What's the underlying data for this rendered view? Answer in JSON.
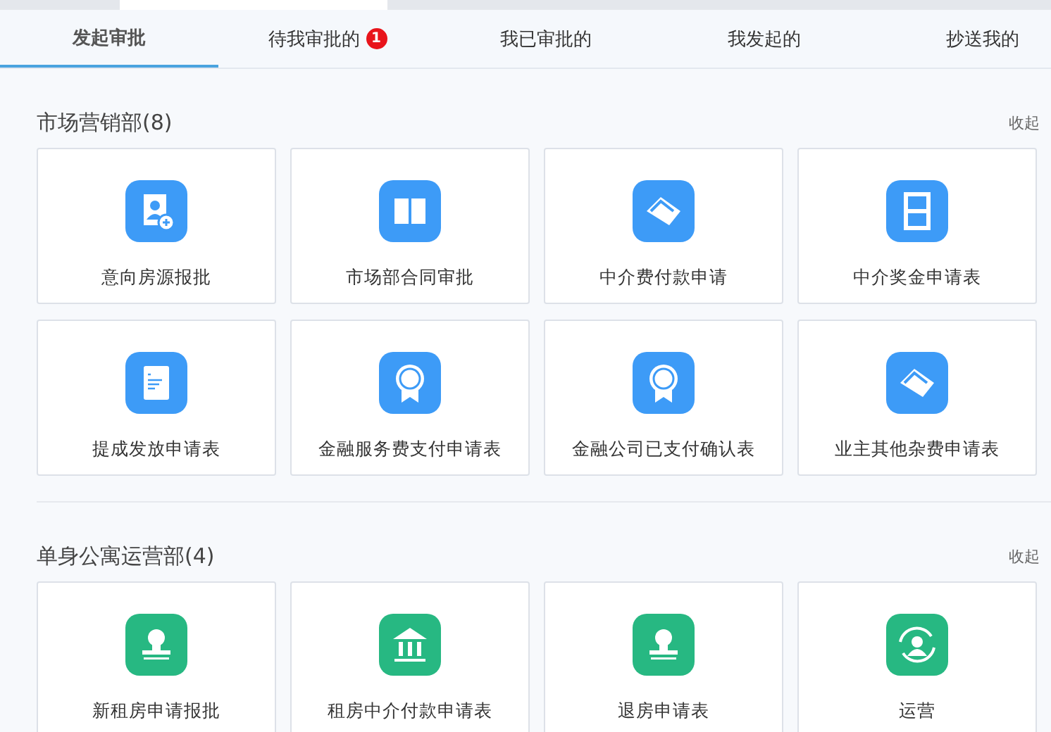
{
  "tabs": [
    {
      "label": "发起审批",
      "selected": true
    },
    {
      "label": "待我审批的",
      "selected": false,
      "badge": "1"
    },
    {
      "label": "我已审批的",
      "selected": false
    },
    {
      "label": "我发起的",
      "selected": false
    },
    {
      "label": "抄送我的",
      "selected": false
    }
  ],
  "sections": [
    {
      "title": "市场营销部(8)",
      "toggle": "收起",
      "color": "#3d9bf7",
      "cards": [
        {
          "label": "意向房源报批",
          "kind": "portrait"
        },
        {
          "label": "市场部合同审批",
          "kind": "book"
        },
        {
          "label": "中介费付款申请",
          "kind": "handshake"
        },
        {
          "label": "中介奖金申请表",
          "kind": "calendar"
        },
        {
          "label": "提成发放申请表",
          "kind": "document"
        },
        {
          "label": "金融服务费支付申请表",
          "kind": "medal"
        },
        {
          "label": "金融公司已支付确认表",
          "kind": "medal"
        },
        {
          "label": "业主其他杂费申请表",
          "kind": "handshake"
        }
      ]
    },
    {
      "title": "单身公寓运营部(4)",
      "toggle": "收起",
      "color": "#27b882",
      "cards": [
        {
          "label": "新租房申请报批",
          "kind": "stamp"
        },
        {
          "label": "租房中介付款申请表",
          "kind": "bank"
        },
        {
          "label": "退房申请表",
          "kind": "stamp"
        },
        {
          "label": "运营",
          "kind": "refresh"
        }
      ]
    }
  ]
}
